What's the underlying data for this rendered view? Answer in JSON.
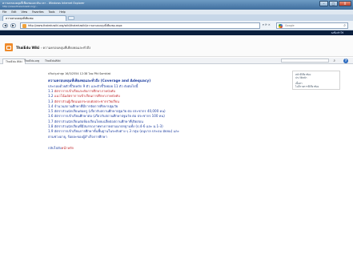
{
  "window": {
    "title": "ความครอบคลุมที่เพียงพอและทันเวลา - Windows Internet Explorer",
    "url_line": "http://www.thaieduwiki.org/...",
    "buttons": [
      "–",
      "□",
      "X"
    ]
  },
  "menubar": [
    "File",
    "Edit",
    "View",
    "Favorites",
    "Tools",
    "Help"
  ],
  "tab": {
    "label": "ความครอบคลุมที่เพียงพอ"
  },
  "navbar": {
    "back": "◀",
    "forward": "▶",
    "url": "http://www.thaieduwiki.org/wiki/thaieduwiki/ความครอบคลุมที่เพียงพอ.aspx",
    "controls": "▾ ⟳ ✕",
    "search_placeholder": "Google"
  },
  "sitebar": {
    "link": "ลงชื่อเข้าใช้"
  },
  "header": {
    "site": "ThaiEdu Wiki",
    "separator": " › ",
    "page": "ความครอบคลุมที่เพียงพอและทั่วถึง"
  },
  "wiki_tabs": [
    "ThaiEdu Wiki",
    "ThaiEdu.org",
    "ThaiEduWiki"
  ],
  "content": {
    "meta": "ปรับปรุงล่าสุด 16/3/2554 12:38 โดย Pitt Somkiat",
    "title": "ความครอบคลุมที่เพียงพอและทั่วถึง (Coverage and Adequacy)",
    "subtitle": "ประกอบด้วยตัวชี้วัดหลัก 9 ตัว และตัวชี้วัดย่อย 11 ตัว ดังต่อไปนี้",
    "items": [
      {
        "num": "1.1",
        "text": "อัตราการเข้าเรียนระดับการศึกษาภาคบังคับ",
        "link": true
      },
      {
        "num": "1.2",
        "text": "แนวโน้มอัตราการเข้าเรียนการศึกษาภาคบังคับ",
        "link": true
      },
      {
        "num": "1.3",
        "text": "อัตราส่วนผู้เรียนนอกระบบต่อประชากรวัยเรียน",
        "link": true
      },
      {
        "num": "1.4",
        "text": "จำนวนสถานศึกษาที่มีการจัดการศึกษาปฐมวัย",
        "link": false
      },
      {
        "num": "1.5",
        "text": "อัตราส่วนนักเรียนต่อครู (เกี่ยวกับสถานศึกษาปฐมวัย ต่อ ประชากร 40,000 คน)",
        "link": false
      },
      {
        "num": "1.6",
        "text": "อัตราการเข้าเรียนศึกษาต่อ (เกี่ยวกับสถานศึกษาปฐมวัย ต่อ ประชากร 100 คน)",
        "link": false
      },
      {
        "num": "1.7",
        "text": "อัตราส่วนนักเรียนต่อห้องเรียนโดยเฉลี่ยต่อสถานศึกษาที่เปิดสอน",
        "link": false
      },
      {
        "num": "1.8",
        "text": "อัตราส่วนนักเรียนที่มีสมรรถภาพทางกายตามมาตรฐานทั้ง (ป.4-6 และ ม.1-3)",
        "link": false
      },
      {
        "num": "1.9",
        "text": "อัตราการเข้าเรียนการศึกษาขั้นพื้นฐานในระดับต่าง ๆ 3 กลุ่ม (อนุบาล ประถม มัธยม) และ",
        "link": false
      }
    ],
    "item_wrap": "ตามช่วงอายุ, ร้อยละของผู้สำเร็จการศึกษา",
    "back_prefix": "กลับไปยัง",
    "back_link": "หน้าหลัก"
  },
  "sidebox": {
    "line1": "หน้าที่เกี่ยวข้อง",
    "line2": "ประวัติหน้า",
    "line3": "เนื้อหา",
    "line4": "ไม่มีรายการที่เกี่ยวข้อง"
  }
}
